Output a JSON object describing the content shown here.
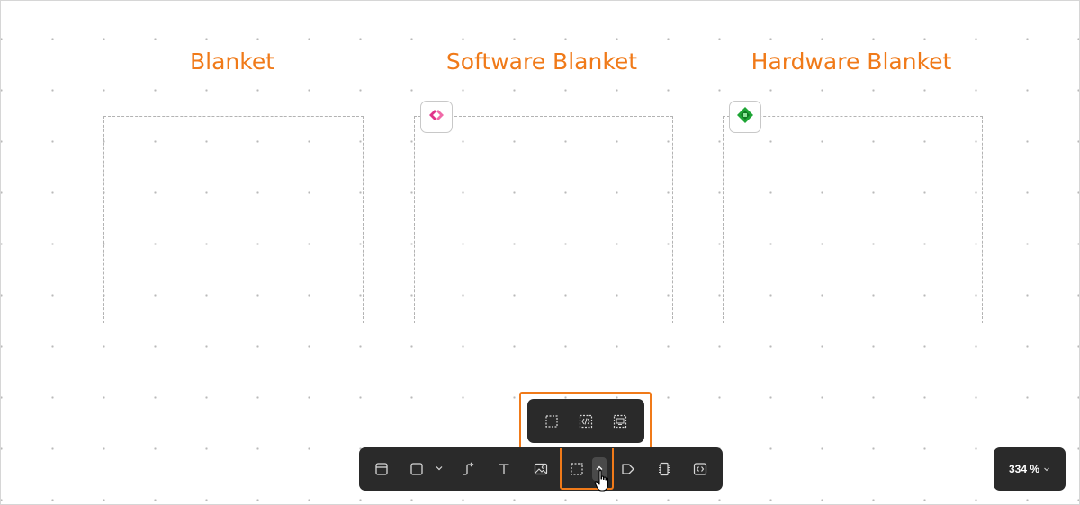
{
  "canvas": {
    "blankets": [
      {
        "title": "Blanket",
        "badge": null
      },
      {
        "title": "Software Blanket",
        "badge": "code-brackets-icon"
      },
      {
        "title": "Hardware Blanket",
        "badge": "hardware-gem-icon"
      }
    ]
  },
  "colors": {
    "accent": "#f07a19",
    "toolbar_bg": "#2a2a2a",
    "software_badge": "#e0328a",
    "hardware_badge": "#1ea535"
  },
  "popup_menu": {
    "items": [
      {
        "icon": "blanket-icon"
      },
      {
        "icon": "software-blanket-icon"
      },
      {
        "icon": "hardware-blanket-icon"
      }
    ]
  },
  "toolbar": {
    "items": [
      {
        "icon": "frame-icon"
      },
      {
        "icon": "rectangle-icon"
      },
      {
        "icon": "shape-chevron-icon"
      },
      {
        "icon": "connector-icon"
      },
      {
        "icon": "text-icon"
      },
      {
        "icon": "image-icon"
      },
      {
        "icon": "blanket-tool-icon"
      },
      {
        "icon": "blanket-chevron-up-icon"
      },
      {
        "icon": "tag-icon"
      },
      {
        "icon": "chip-icon"
      },
      {
        "icon": "code-block-icon"
      }
    ]
  },
  "zoom": {
    "value": "334 %"
  }
}
